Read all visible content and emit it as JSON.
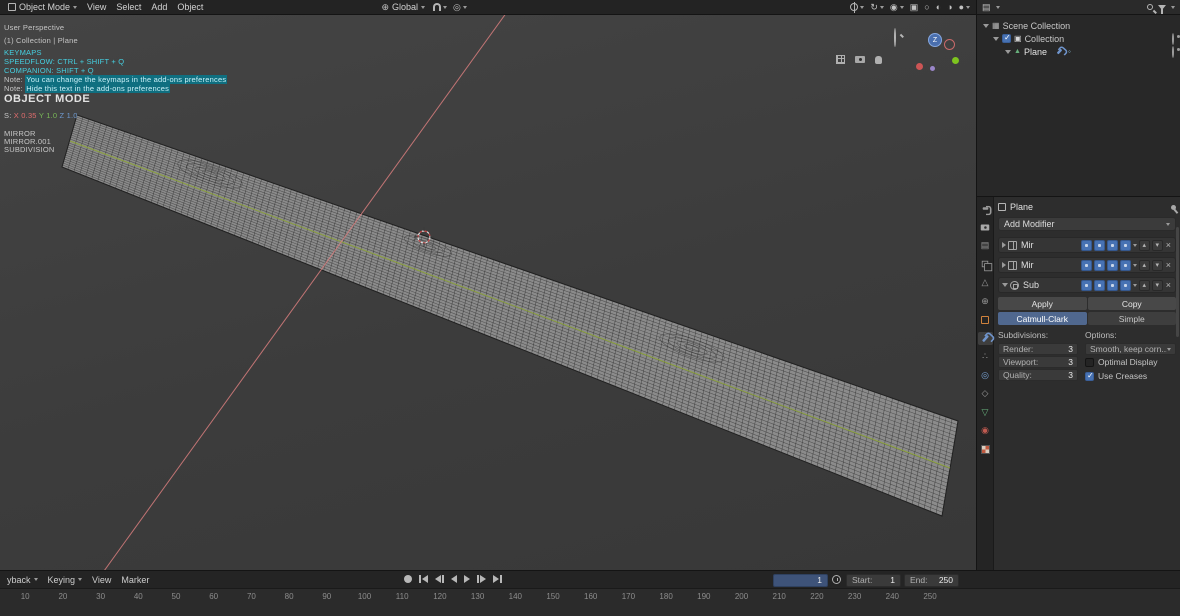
{
  "header": {
    "mode": {
      "label": "Object Mode"
    },
    "menus": [
      {
        "label": "View"
      },
      {
        "label": "Select"
      },
      {
        "label": "Add"
      },
      {
        "label": "Object"
      }
    ],
    "orientation": {
      "label": "Global"
    }
  },
  "icons": {
    "close": "×",
    "check": "✓",
    "globe": "⊕",
    "proportional": "◎",
    "falloff": "◠",
    "overlays": "◉",
    "gizmo": "↻",
    "xray": "▣",
    "wireframe": "○",
    "solid": "◐",
    "material_preview": "◑",
    "rendered": "●",
    "outliner_editor": "▤",
    "scene": "▦",
    "collection_box": "▣",
    "mesh_triangle": "▲",
    "nodes": "◦",
    "up": "▴",
    "down": "▾",
    "tool": "⚒",
    "output": "▤",
    "scene_tab": "△",
    "world_tab": "⊕",
    "particles_tab": "∴",
    "physics_tab": "◎",
    "constraints_tab": "◇",
    "data_tab": "▽",
    "material_tab": "◉"
  },
  "viewport_overlay": {
    "perspective": "User Perspective",
    "context": "(1) Collection | Plane",
    "keymaps_title": "KEYMAPS",
    "keymap_speedflow": "SPEEDFLOW: CTRL + SHIFT + Q",
    "keymap_companion": "COMPANION: SHIFT + Q",
    "note1_label": "Note:",
    "note1_text": "You can change the keymaps in the add-ons preferences",
    "note2_label": "Note:",
    "note2_text": "Hide this text in the add-ons preferences",
    "mode_banner": "OBJECT MODE",
    "scale_label": "S:",
    "scale_x": "X 0.35",
    "scale_y": "Y 1.0",
    "scale_z": "Z 1.0",
    "modifier_list": [
      "MIRROR",
      "MIRROR.001",
      "SUBDIVISION"
    ],
    "gizmo_z_label": "Z"
  },
  "outliner": {
    "rows": [
      {
        "label": "Scene Collection"
      },
      {
        "label": "Collection"
      },
      {
        "label": "Plane"
      }
    ]
  },
  "properties": {
    "breadcrumb": "Plane",
    "add_modifier_label": "Add Modifier",
    "modifier_rows": [
      {
        "name": "Mir"
      },
      {
        "name": "Mir"
      },
      {
        "name": "Sub"
      }
    ],
    "subsurf": {
      "apply": "Apply",
      "copy": "Copy",
      "catmull_clark": "Catmull-Clark",
      "simple": "Simple",
      "subdivisions_label": "Subdivisions:",
      "options_label": "Options:",
      "render_label": "Render:",
      "render_value": "3",
      "viewport_label": "Viewport:",
      "viewport_value": "3",
      "quality_label": "Quality:",
      "quality_value": "3",
      "uv_smooth": "Smooth, keep corn...",
      "optimal_display": "Optimal Display",
      "use_creases": "Use Creases"
    }
  },
  "timeline": {
    "menus": [
      {
        "label": "yback"
      },
      {
        "label": "Keying"
      },
      {
        "label": "View"
      },
      {
        "label": "Marker"
      }
    ],
    "current_frame": "1",
    "start_label": "Start:",
    "start_value": "1",
    "end_label": "End:",
    "end_value": "250",
    "ruler_ticks": [
      "10",
      "20",
      "30",
      "40",
      "50",
      "60",
      "70",
      "80",
      "90",
      "100",
      "110",
      "120",
      "130",
      "140",
      "150",
      "160",
      "170",
      "180",
      "190",
      "200",
      "210",
      "220",
      "230",
      "240",
      "250"
    ]
  },
  "colors": {
    "accent_blue": "#4772b3",
    "axis_x_red": "#d87e7e",
    "axis_y_green": "#90a83b",
    "overlay_cyan": "#45cfe0"
  }
}
